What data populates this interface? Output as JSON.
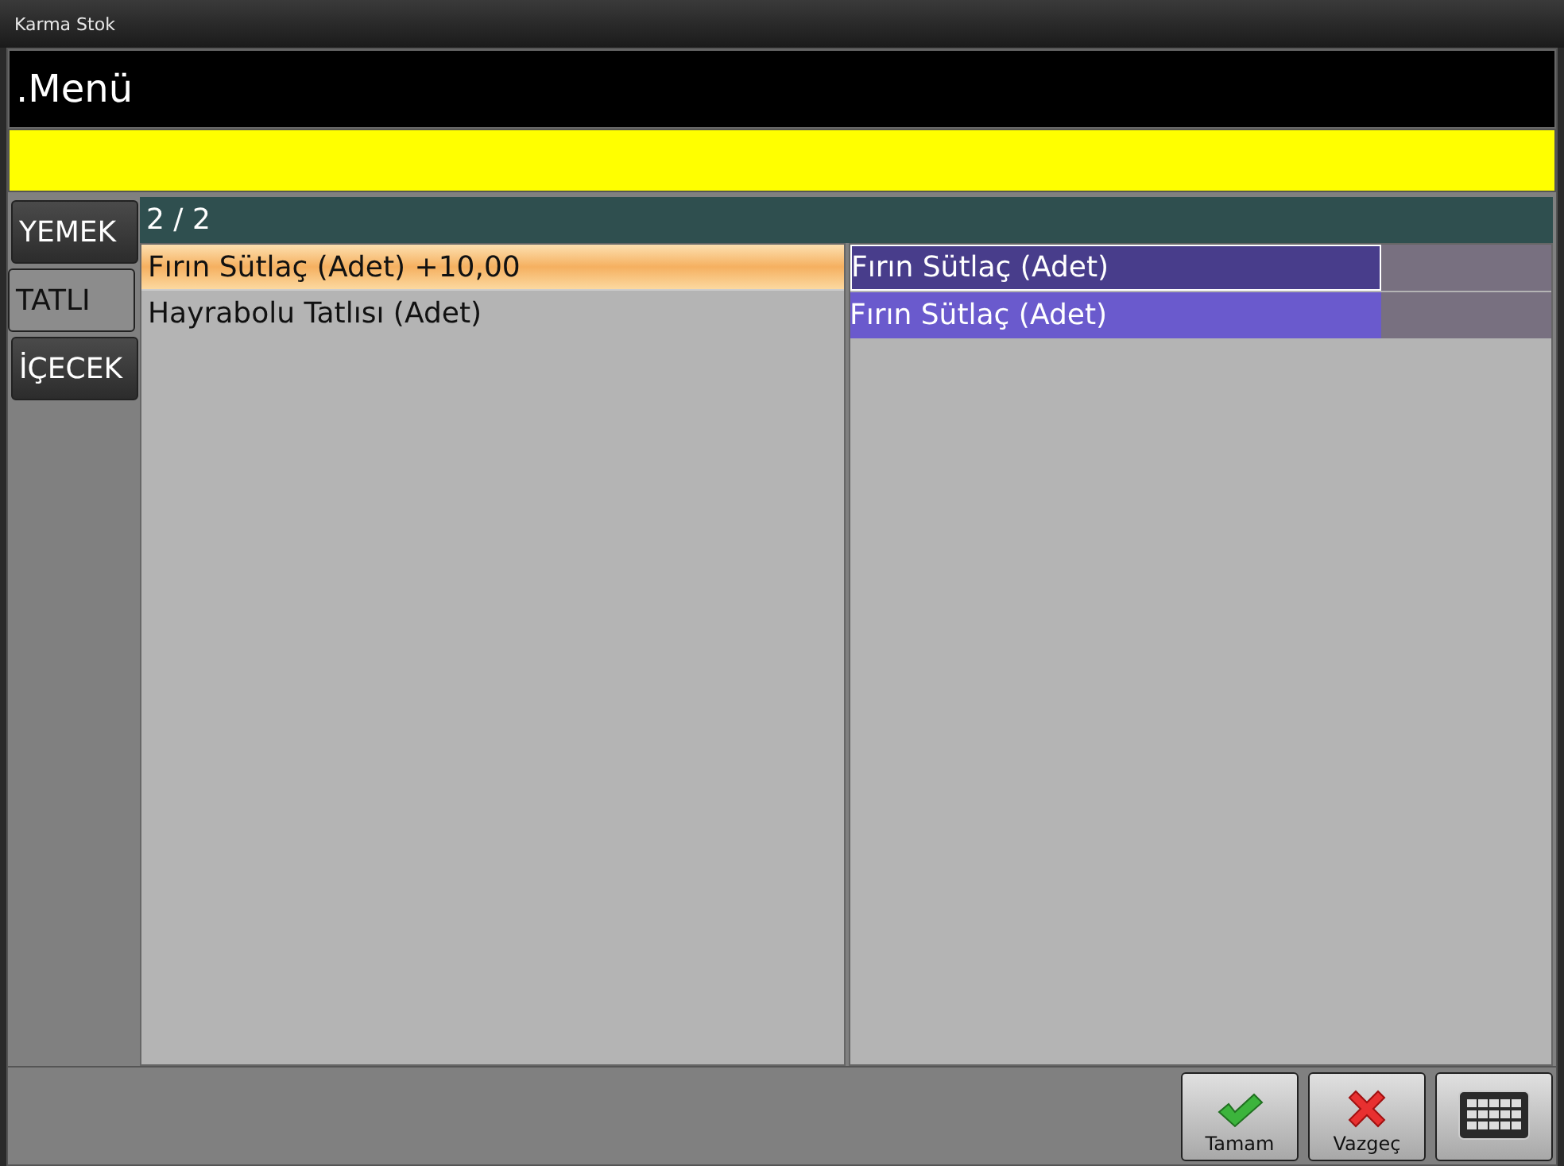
{
  "window": {
    "title": "Karma Stok"
  },
  "header": {
    "title": ".Menü"
  },
  "categories": [
    {
      "label": "YEMEK",
      "selected": false
    },
    {
      "label": "TATLI",
      "selected": true
    },
    {
      "label": "İÇECEK",
      "selected": false
    }
  ],
  "counter": "2 / 2",
  "items": [
    {
      "label": "Fırın Sütlaç (Adet) +10,00",
      "selected": true
    },
    {
      "label": "Hayrabolu Tatlısı (Adet)",
      "selected": false
    }
  ],
  "chosen": [
    {
      "label": "Fırın Sütlaç (Adet)",
      "selected": true
    },
    {
      "label": "Fırın Sütlaç (Adet)",
      "selected": false
    }
  ],
  "buttons": [
    {
      "kind": "ok",
      "label": "Tamam"
    },
    {
      "kind": "cancel",
      "label": "Vazgeç"
    },
    {
      "kind": "keyboard"
    }
  ]
}
